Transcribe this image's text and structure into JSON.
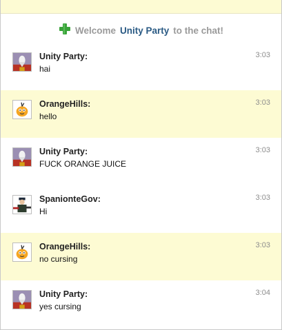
{
  "welcome": {
    "prefix": "Welcome",
    "name": "Unity Party",
    "suffix": "to the chat!",
    "icon": "plus-icon"
  },
  "messages": [
    {
      "user": "Unity Party:",
      "text": "hai",
      "time": "3:03",
      "avatar": "unity-party-avatar",
      "highlight": false
    },
    {
      "user": "OrangeHills:",
      "text": "hello",
      "time": "3:03",
      "avatar": "orangehills-avatar",
      "highlight": true
    },
    {
      "user": "Unity Party:",
      "text": "FUCK ORANGE JUICE",
      "time": "3:03",
      "avatar": "unity-party-avatar",
      "highlight": false
    },
    {
      "user": "SpanionteGov:",
      "text": "Hi",
      "time": "3:03",
      "avatar": "spaniontegov-avatar",
      "highlight": false
    },
    {
      "user": "OrangeHills:",
      "text": "no cursing",
      "time": "3:03",
      "avatar": "orangehills-avatar",
      "highlight": true
    },
    {
      "user": "Unity Party:",
      "text": "yes cursing",
      "time": "3:04",
      "avatar": "unity-party-avatar",
      "highlight": false
    }
  ],
  "colors": {
    "highlight_bg": "#fdfbd3",
    "name_link": "#2a5a84",
    "plus_green": "#3aa33a"
  }
}
